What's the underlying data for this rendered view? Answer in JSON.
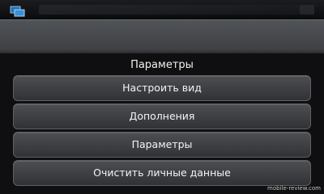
{
  "menu": {
    "title": "Параметры",
    "items": [
      {
        "label": "Настроить вид"
      },
      {
        "label": "Дополнения"
      },
      {
        "label": "Параметры"
      },
      {
        "label": "Очистить личные данные"
      }
    ]
  },
  "watermark": "mobile-review.com",
  "icons": {
    "task_switcher": "task-switcher-icon"
  },
  "colors": {
    "menu_background": "#0f0f11",
    "button_border": "#5e6064",
    "task_icon": "#3d8fd1"
  }
}
